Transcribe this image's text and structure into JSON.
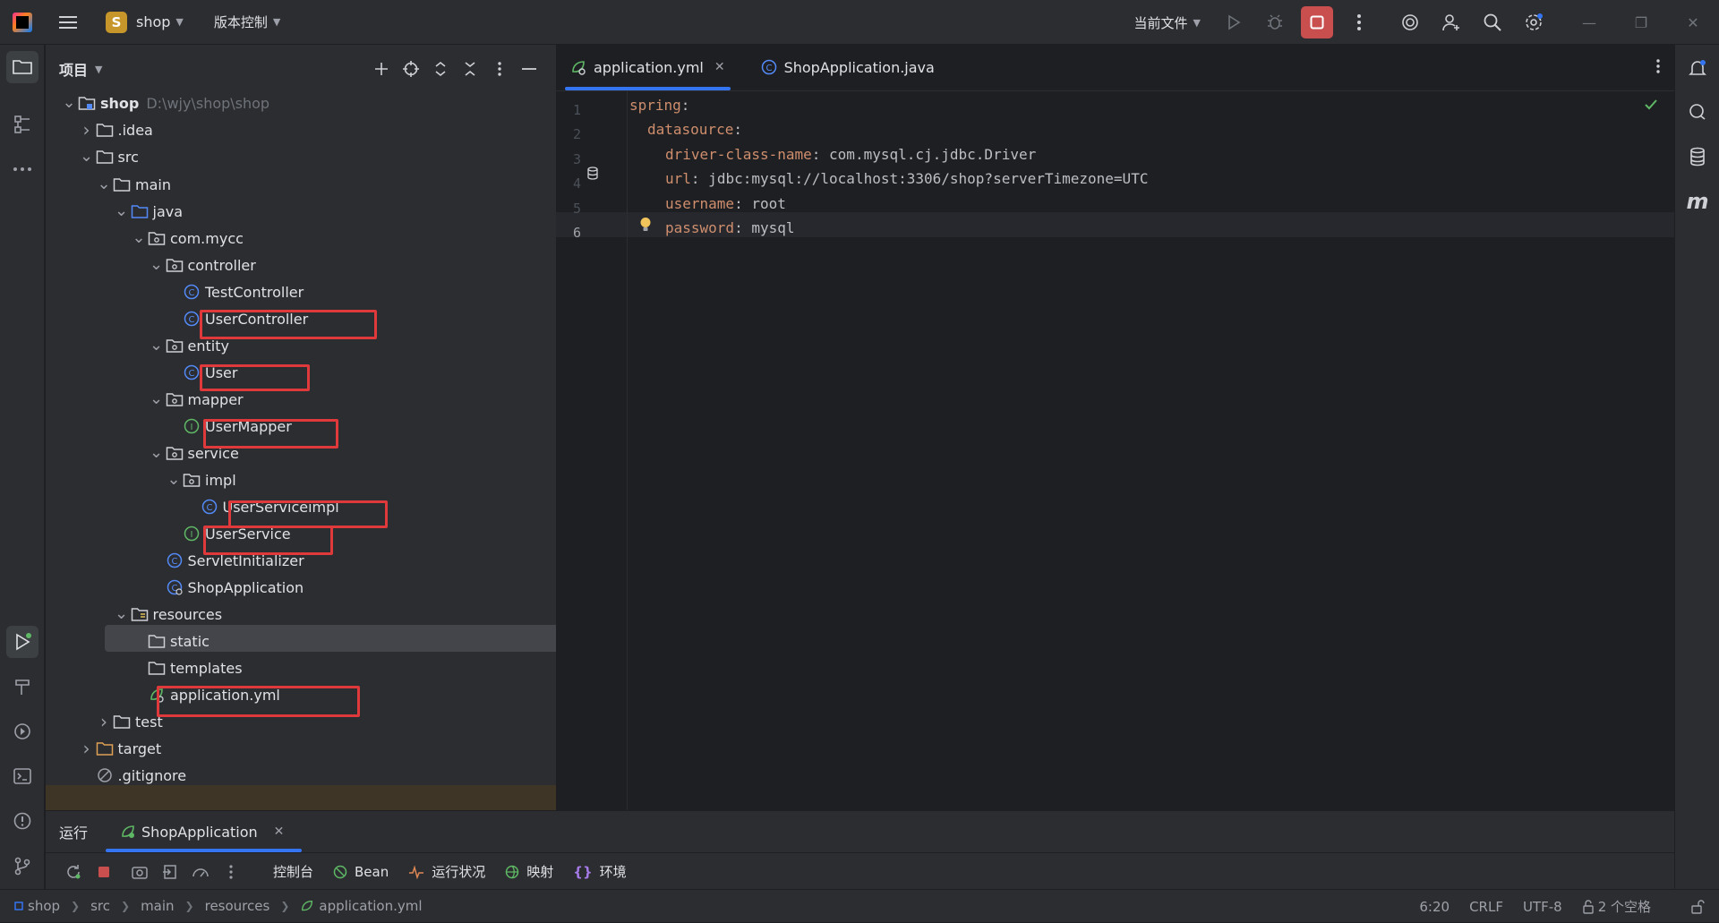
{
  "titlebar": {
    "project_badge": "S",
    "project_name": "shop",
    "vcs_label": "版本控制",
    "run_config": "当前文件"
  },
  "project_panel": {
    "title": "项目",
    "tree": [
      {
        "label": "shop",
        "path": "D:\\wjy\\shop\\shop"
      },
      {
        "label": ".idea"
      },
      {
        "label": "src"
      },
      {
        "label": "main"
      },
      {
        "label": "java"
      },
      {
        "label": "com.mycc"
      },
      {
        "label": "controller"
      },
      {
        "label": "TestController"
      },
      {
        "label": "UserController"
      },
      {
        "label": "entity"
      },
      {
        "label": "User"
      },
      {
        "label": "mapper"
      },
      {
        "label": "UserMapper"
      },
      {
        "label": "service"
      },
      {
        "label": "impl"
      },
      {
        "label": "UserServiceimpl"
      },
      {
        "label": "UserService"
      },
      {
        "label": "ServletInitializer"
      },
      {
        "label": "ShopApplication"
      },
      {
        "label": "resources"
      },
      {
        "label": "static"
      },
      {
        "label": "templates"
      },
      {
        "label": "application.yml"
      },
      {
        "label": "test"
      },
      {
        "label": "target"
      },
      {
        "label": ".gitignore"
      }
    ]
  },
  "editor": {
    "tabs": [
      {
        "label": "application.yml",
        "close": "✕"
      },
      {
        "label": "ShopApplication.java"
      }
    ],
    "line_numbers": [
      "1",
      "2",
      "3",
      "4",
      "5",
      "6"
    ],
    "lines": [
      {
        "key": "spring",
        "sep": ":",
        "value": ""
      },
      {
        "key": "datasource",
        "sep": ":",
        "value": ""
      },
      {
        "key": "driver-class-name",
        "sep": ":",
        "value": " com.mysql.cj.jdbc.Driver"
      },
      {
        "key": "url",
        "sep": ":",
        "value": " jdbc:mysql://localhost:3306/shop?serverTimezone=UTC"
      },
      {
        "key": "username",
        "sep": ":",
        "value": " root"
      },
      {
        "key": "password",
        "sep": ":",
        "value": " mysql"
      }
    ]
  },
  "bottom_panel": {
    "title": "运行",
    "tab_label": "ShopApplication",
    "tab_close": "✕",
    "tools": {
      "console": "控制台",
      "bean": "Bean",
      "health": "运行状况",
      "mappings": "映射",
      "env": "环境"
    }
  },
  "statusbar": {
    "breadcrumb": [
      "shop",
      "src",
      "main",
      "resources",
      "application.yml"
    ],
    "position": "6:20",
    "line_sep": "CRLF",
    "encoding": "UTF-8",
    "indent": "2 个空格"
  },
  "colors": {
    "accent": "#3574f0",
    "highlight_box": "#e0393c",
    "yaml_key": "#cf8e6d"
  }
}
